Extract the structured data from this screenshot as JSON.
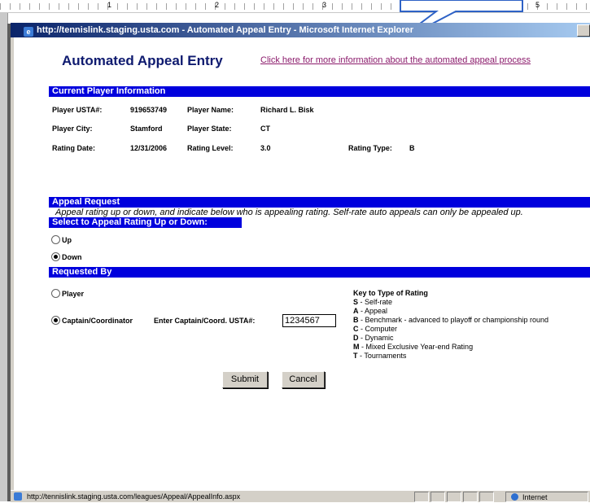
{
  "ruler": {
    "numbers": [
      "1",
      "2",
      "3",
      "5"
    ]
  },
  "window": {
    "title": "http://tennislink.staging.usta.com - Automated Appeal Entry - Microsoft Internet Explorer",
    "status_url": "http://tennislink.staging.usta.com/leagues/Appeal/AppealInfo.aspx",
    "status_zone": "Internet"
  },
  "page": {
    "title": "Automated Appeal Entry",
    "info_link": "Click here for more information about the automated appeal process"
  },
  "player_info": {
    "header": "Current Player Information",
    "usta_label": "Player USTA#:",
    "usta_value": "919653749",
    "name_label": "Player Name:",
    "name_value": "Richard L. Bisk",
    "city_label": "Player City:",
    "city_value": "Stamford",
    "state_label": "Player State:",
    "state_value": "CT",
    "date_label": "Rating Date:",
    "date_value": "12/31/2006",
    "level_label": "Rating Level:",
    "level_value": "3.0",
    "type_label": "Rating Type:",
    "type_value": "B"
  },
  "appeal": {
    "header": "Appeal Request",
    "description": "Appeal rating up or down, and indicate below who is appealing rating. Self-rate auto appeals can only be appealed up.",
    "direction_header": "Select to Appeal Rating Up or Down:",
    "up_label": "Up",
    "down_label": "Down",
    "selected": "Down"
  },
  "requested_by": {
    "header": "Requested By",
    "player_label": "Player",
    "captain_label": "Captain/Coordinator",
    "selected": "Captain/Coordinator",
    "usta_field_label": "Enter Captain/Coord. USTA#:",
    "usta_field_value": "1234567"
  },
  "key": {
    "title": "Key to Type of Rating",
    "items": [
      {
        "code": "S",
        "text": " - Self-rate"
      },
      {
        "code": "A",
        "text": " - Appeal"
      },
      {
        "code": "B",
        "text": " - Benchmark - advanced to playoff or championship round"
      },
      {
        "code": "C",
        "text": " - Computer"
      },
      {
        "code": "D",
        "text": " - Dynamic"
      },
      {
        "code": "M",
        "text": " - Mixed Exclusive Year-end Rating"
      },
      {
        "code": "T",
        "text": " - Tournaments"
      }
    ]
  },
  "buttons": {
    "submit": "Submit",
    "cancel": "Cancel"
  },
  "colors": {
    "section_bar": "#0000dd",
    "title": "#0e1a6f",
    "link": "#8b1a6b"
  }
}
